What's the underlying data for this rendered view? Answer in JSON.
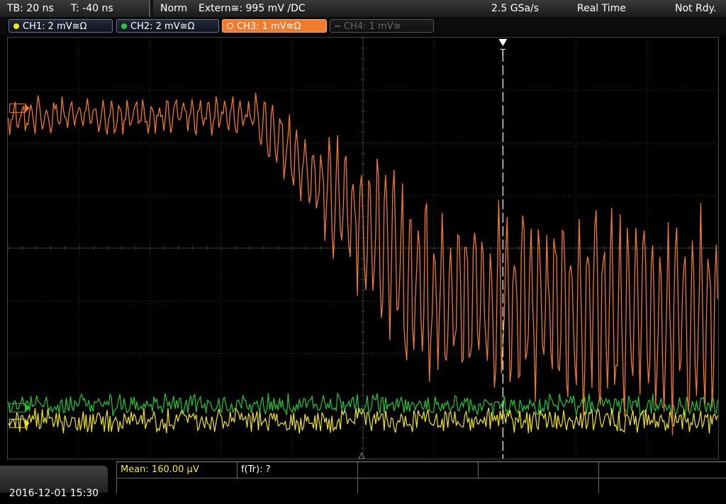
{
  "header": {
    "timebase": "TB: 20 ns",
    "trigger_time": "T: -40 ns",
    "mode": "Norm",
    "trigger_source": "Extern≅: 995 mV ∕DC",
    "sample_rate": "2.5 GSa/s",
    "acq_mode": "Real Time",
    "state": "Not Rdy."
  },
  "channels": [
    {
      "label": "CH1: 2 mV≅Ω",
      "color": "#f5e91c",
      "state": "on"
    },
    {
      "label": "CH2: 2 mV≅Ω",
      "color": "#22c83a",
      "state": "on"
    },
    {
      "label": "CH3: 1 mV≅Ω",
      "color": "#f07a2e",
      "state": "active"
    },
    {
      "label": "CH4: 1 mV≅",
      "color": "#777777",
      "state": "off"
    }
  ],
  "measurements": {
    "mean": "Mean: 160.00 μV",
    "rise": "f(Tr): ?"
  },
  "datetime": "2016-12-01 15:30",
  "colors": {
    "grid": "#3a3a3a",
    "ch1": "#f5e91c",
    "ch2": "#22c83a",
    "ch3": "#f07a2e"
  }
}
